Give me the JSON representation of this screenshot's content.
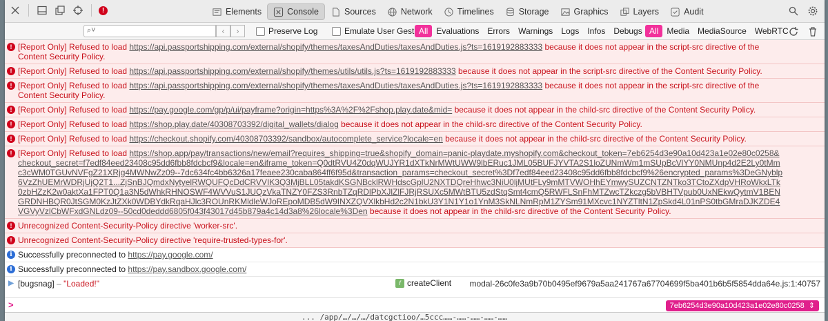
{
  "tabbar": {
    "tabs": [
      {
        "label": "Elements",
        "icon": "elements-icon"
      },
      {
        "label": "Console",
        "icon": "console-icon",
        "active": true
      },
      {
        "label": "Sources",
        "icon": "sources-icon"
      },
      {
        "label": "Network",
        "icon": "network-icon"
      },
      {
        "label": "Timelines",
        "icon": "timelines-icon"
      },
      {
        "label": "Storage",
        "icon": "storage-icon"
      },
      {
        "label": "Graphics",
        "icon": "graphics-icon"
      },
      {
        "label": "Layers",
        "icon": "layers-icon"
      },
      {
        "label": "Audit",
        "icon": "audit-icon"
      }
    ],
    "error_count_glyph": "!"
  },
  "filterbar": {
    "search_placeholder": "",
    "preserve_log": "Preserve Log",
    "emulate_gesture": "Emulate User Gesture",
    "level_filters": [
      "All",
      "Evaluations",
      "Errors",
      "Warnings",
      "Logs",
      "Infos",
      "Debugs"
    ],
    "source_filters": [
      "All",
      "Media",
      "MediaSource",
      "WebRTC"
    ]
  },
  "messages": [
    {
      "type": "error",
      "prefix": "[Report Only] Refused to load ",
      "url": "https://api.passportshipping.com/external/shopify/themes/taxesAndDuties/taxesAndDuties.js?ts=1619192883333",
      "suffix": " because it does not appear in the script-src directive of the Content Security Policy."
    },
    {
      "type": "error",
      "prefix": "[Report Only] Refused to load ",
      "url": "https://api.passportshipping.com/external/shopify/themes/utils/utils.js?ts=1619192883333",
      "suffix": " because it does not appear in the script-src directive of the Content Security Policy."
    },
    {
      "type": "error",
      "prefix": "[Report Only] Refused to load ",
      "url": "https://api.passportshipping.com/external/shopify/themes/taxesAndDuties/taxesAndDuties.js?ts=1619192883333",
      "suffix": " because it does not appear in the script-src directive of the Content Security Policy."
    },
    {
      "type": "error",
      "prefix": "[Report Only] Refused to load ",
      "url": "https://pay.google.com/gp/p/ui/payframe?origin=https%3A%2F%2Fshop.play.date&mid=",
      "suffix": " because it does not appear in the child-src directive of the Content Security Policy."
    },
    {
      "type": "error",
      "prefix": "[Report Only] Refused to load ",
      "url": "https://shop.play.date/40308703392/digital_wallets/dialog",
      "suffix": " because it does not appear in the child-src directive of the Content Security Policy."
    },
    {
      "type": "error",
      "prefix": "[Report Only] Refused to load ",
      "url": "https://checkout.shopify.com/40308703392/sandbox/autocomplete_service?locale=en",
      "suffix": " because it does not appear in the child-src directive of the Content Security Policy."
    },
    {
      "type": "error",
      "prefix": "[Report Only] Refused to load ",
      "url": "https://shop.app/pay/transactions/new/email?requires_shipping=true&shopify_domain=panic-playdate.myshopify.com&checkout_token=7eb6254d3e90a10d423a1e02e80c0258&checkout_secret=f7edf84eed23408c95dd6fbb8fdcbcf9&locale=en&iframe_token=Q0dtRVU4Z0dqWUJYR1dXTkNrMWtUWW9lbERuc1JML05BUFJYVTA2S1loZUNmWm1mSUpBcVlYY0NMUnp4d2E2Ly0tMmc3cWM0TGUvNVFgZ21XRjg4MWNwZz09--7dc634fc4bb6326a17feaee230caba864ff6f95d&transaction_params=checkout_secret%3Df7edf84eed23408c95dd6fbb8fdcbcf9%26encrypted_params%3DeGNyblp6VzZhUEMrWDRjUjQ2T1...ZjSnBJQmdxNytyelRWQUFQcDdCRVVIK3Q3MjBLL05takdKSGNBcklRWHdscGplU2NXTDQreHhwc3NiU0ljMUtFLy9mMTVWOHhEYmwySUZCNTZNTko3TCtoZXdpVHRoWkxLTk0zbHZzK2w0aktXa1FPT0Q1a3N5dWhkRHNOSWF4WVVuS1JUQzVkaTNZY0FZS3RnbTZqRDlPbXJlZlFJRjRSUXc5MWtBTU5zdStqSmt4cmQ5RWFLSnFhMTZwcTZkczg5bVBHTVpub0UxNEkwQytmV1BENGRDNHBQR0JtSGM0KzJtZXk0WDBYdkRqaHJlc3ROUnRKMldleWJoREpoMDB5dW9INXZQVXlkbHd2c2N1bkU3Y1N1Y1o1YnM3SkNLNmRpM1ZYSm91MXcvc1NYZTltN1ZpSkd4L01nPS0tbGMraDJKZDE4VGVyVzlCbWFxdGNLdz09--50cd0deddd6805f043f43017d45b879a4c14d3a8%26locale%3Den",
      "suffix": " because it does not appear in the child-src directive of the Content Security Policy."
    },
    {
      "type": "error",
      "prefix": "Unrecognized Content-Security-Policy directive 'worker-src'.",
      "url": "",
      "suffix": ""
    },
    {
      "type": "error",
      "prefix": "Unrecognized Content-Security-Policy directive 'require-trusted-types-for'.",
      "url": "",
      "suffix": ""
    },
    {
      "type": "info",
      "prefix": "Successfully preconnected to ",
      "url": "https://pay.google.com/",
      "suffix": ""
    },
    {
      "type": "info",
      "prefix": "Successfully preconnected to ",
      "url": "https://pay.sandbox.google.com/",
      "suffix": ""
    }
  ],
  "log_row": {
    "tag": "[bugsnag]",
    "dash": " – ",
    "value": "\"Loaded!\"",
    "function_badge": "createClient",
    "function_icon_glyph": "f",
    "source": "modal-26c0fe3a9b70b0495ef9679a5aa241767a67704699f5ba401b6b5f5854dda64e.js:1:40757"
  },
  "prompt": {
    "caret": ">",
    "execution_context": "7eb6254d3e90a10d423a1e02e80c0258"
  },
  "bottom_strip": "... /app/…/…/…/datcgctioo/…5ccc……-……-……-……-……"
}
